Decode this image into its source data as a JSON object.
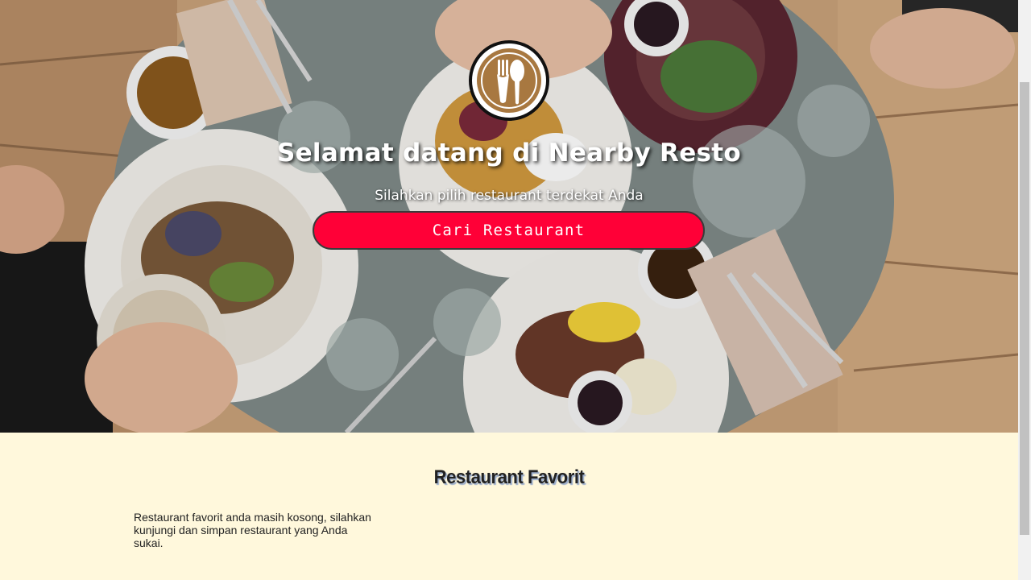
{
  "hero": {
    "title": "Selamat datang di Nearby Resto",
    "subtitle": "Silahkan pilih restaurant terdekat Anda",
    "button_label": "Cari Restaurant",
    "logo_icon": "fork-spoon-icon",
    "button_color": "#ff0037"
  },
  "favorites": {
    "title": "Restaurant Favorit",
    "empty_message": "Restaurant favorit anda masih kosong, silahkan kunjungi dan simpan restaurant yang Anda sukai."
  },
  "colors": {
    "section_background": "#fff8dc",
    "logo_accent": "#a87840"
  }
}
